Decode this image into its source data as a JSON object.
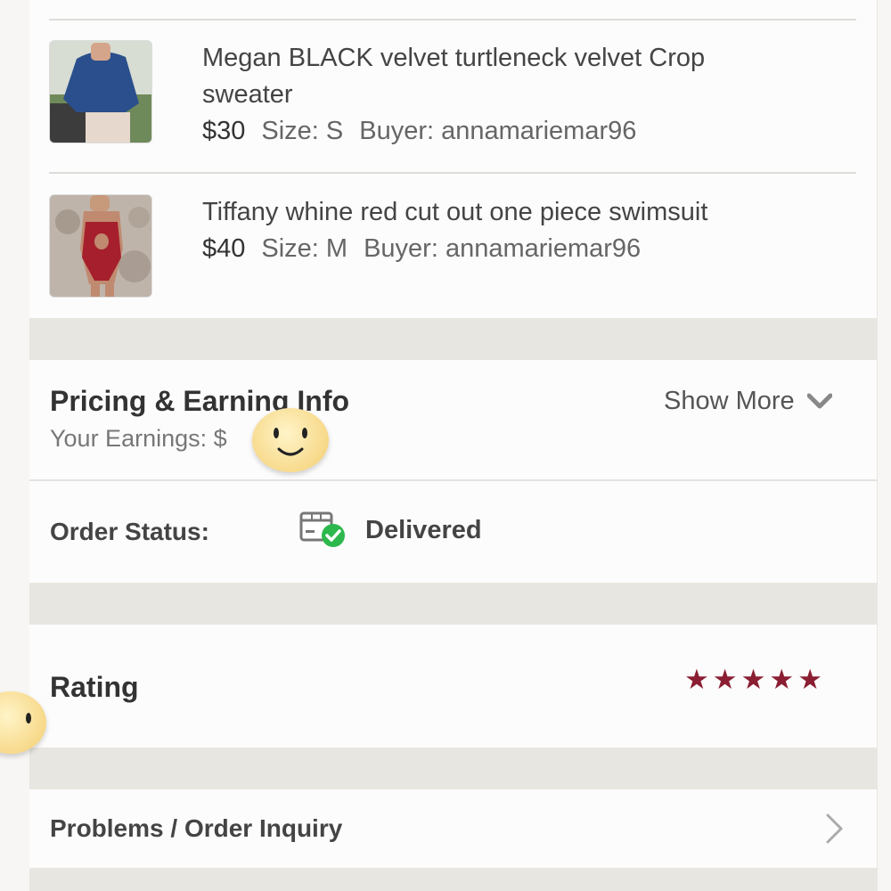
{
  "order_items": [
    {
      "title_line1": "Megan BLACK velvet turtleneck velvet Crop",
      "title_line2": "sweater",
      "price": "$30",
      "size": "Size: S",
      "buyer": "Buyer: annamariemar96",
      "thumb_icon": "blue-sweater-photo"
    },
    {
      "title_line1": "Tiffany whine red cut out one piece swimsuit",
      "price": "$40",
      "size": "Size: M",
      "buyer": "Buyer: annamariemar96",
      "thumb_icon": "red-swimsuit-photo"
    }
  ],
  "pricing": {
    "title": "Pricing & Earning Info",
    "earnings_label": "Your Earnings: $",
    "show_more": "Show More",
    "chevron_icon": "chevron-down-icon"
  },
  "order_status": {
    "label": "Order Status:",
    "value": "Delivered",
    "icon": "package-delivered-icon",
    "icon_color": "#2db84d"
  },
  "rating": {
    "label": "Rating",
    "stars": 5,
    "star_color": "#8b1e32"
  },
  "problems": {
    "label": "Problems / Order Inquiry",
    "chevron_icon": "chevron-right-icon"
  }
}
